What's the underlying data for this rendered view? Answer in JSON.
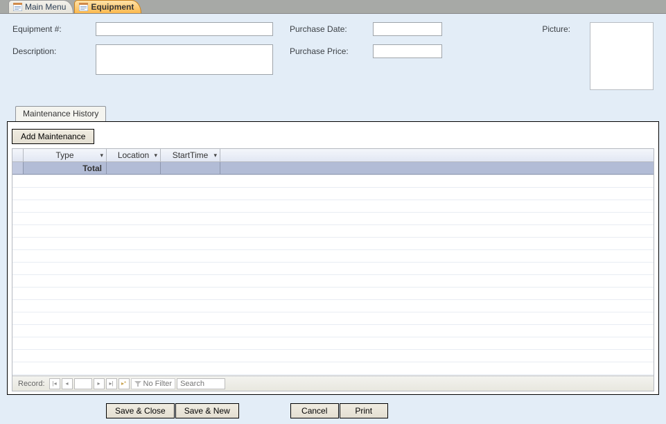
{
  "tabs": {
    "main_menu": "Main Menu",
    "equipment": "Equipment"
  },
  "header": {
    "equipment_num_label": "Equipment #:",
    "equipment_num_value": "",
    "description_label": "Description:",
    "description_value": "",
    "purchase_date_label": "Purchase Date:",
    "purchase_date_value": "",
    "purchase_price_label": "Purchase Price:",
    "purchase_price_value": "",
    "picture_label": "Picture:"
  },
  "inner_tab": {
    "maintenance_history_label": "Maintenance History",
    "add_maintenance_label": "Add Maintenance",
    "columns": {
      "type": "Type",
      "location": "Location",
      "start_time": "StartTime"
    },
    "total_label": "Total",
    "record_nav": {
      "label": "Record:",
      "no_filter": "No Filter",
      "search_placeholder": "Search"
    }
  },
  "buttons": {
    "save_close": "Save & Close",
    "save_new": "Save & New",
    "cancel": "Cancel",
    "print": "Print"
  }
}
